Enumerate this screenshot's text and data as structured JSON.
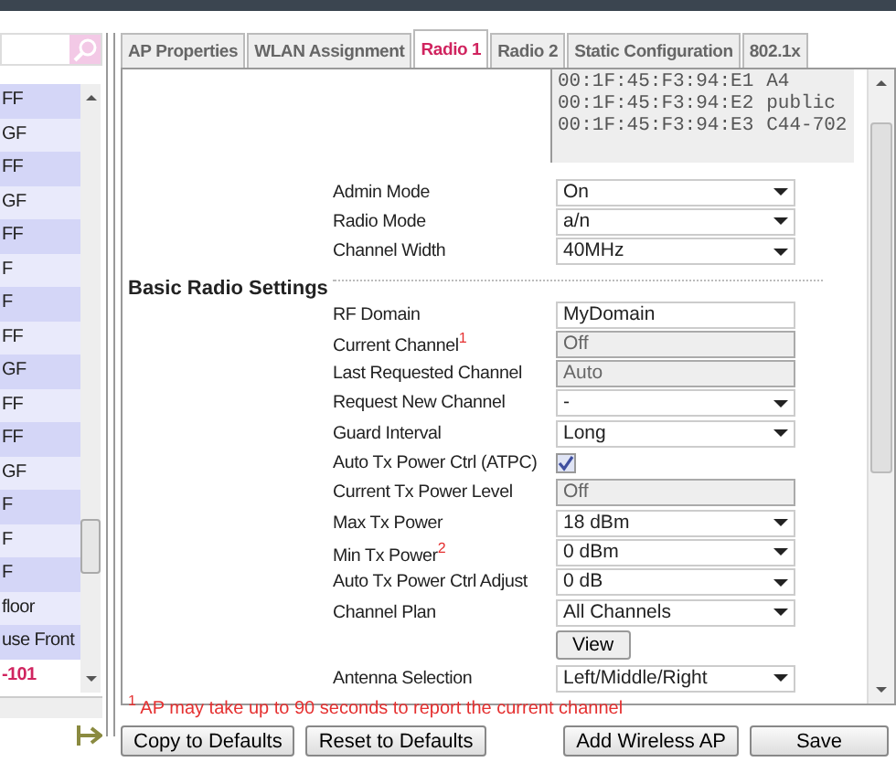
{
  "sidebar": {
    "items": [
      {
        "label": "FF",
        "selected": false
      },
      {
        "label": "GF",
        "selected": false
      },
      {
        "label": "FF",
        "selected": false
      },
      {
        "label": "GF",
        "selected": false
      },
      {
        "label": "FF",
        "selected": false
      },
      {
        "label": "F",
        "selected": false
      },
      {
        "label": "F",
        "selected": false
      },
      {
        "label": "FF",
        "selected": false
      },
      {
        "label": "GF",
        "selected": false
      },
      {
        "label": "FF",
        "selected": false
      },
      {
        "label": "FF",
        "selected": false
      },
      {
        "label": "GF",
        "selected": false
      },
      {
        "label": "F",
        "selected": false
      },
      {
        "label": "F",
        "selected": false
      },
      {
        "label": "F",
        "selected": false
      },
      {
        "label": "floor",
        "selected": false
      },
      {
        "label": "use Front",
        "selected": false
      },
      {
        "label": "-101",
        "selected": true
      }
    ]
  },
  "tabs": [
    {
      "label": "AP Properties",
      "selected": false
    },
    {
      "label": "WLAN Assignment",
      "selected": false
    },
    {
      "label": "Radio 1",
      "selected": true
    },
    {
      "label": "Radio 2",
      "selected": false
    },
    {
      "label": "Static Configuration",
      "selected": false
    },
    {
      "label": "802.1x",
      "selected": false
    }
  ],
  "wlan_list": [
    {
      "mac": "00:1F:45:F3:94:E1",
      "name": "A4"
    },
    {
      "mac": "00:1F:45:F3:94:E2",
      "name": "public"
    },
    {
      "mac": "00:1F:45:F3:94:E3",
      "name": "C44-702"
    }
  ],
  "top_fields": [
    {
      "label": "Admin Mode",
      "kind": "select",
      "value": "On"
    },
    {
      "label": "Radio Mode",
      "kind": "select",
      "value": "a/n"
    },
    {
      "label": "Channel Width",
      "kind": "select",
      "value": "40MHz"
    }
  ],
  "basic_radio_settings": {
    "heading": "Basic Radio Settings",
    "fields": [
      {
        "label": "RF Domain",
        "kind": "text",
        "value": "MyDomain"
      },
      {
        "label": "Current Channel",
        "note": "1",
        "kind": "readonly",
        "value": "Off"
      },
      {
        "label": "Last Requested Channel",
        "kind": "readonly",
        "value": "Auto"
      },
      {
        "label": "Request New Channel",
        "kind": "select",
        "value": "-"
      },
      {
        "label": "Guard Interval",
        "kind": "select",
        "value": "Long"
      },
      {
        "label": "Auto Tx Power Ctrl (ATPC)",
        "kind": "checkbox",
        "checked": true
      },
      {
        "label": "Current Tx Power Level",
        "kind": "readonly",
        "value": "Off"
      },
      {
        "label": "Max Tx Power",
        "kind": "select",
        "value": "18 dBm"
      },
      {
        "label": "Min Tx Power",
        "note": "2",
        "kind": "select",
        "value": "0 dBm"
      },
      {
        "label": "Auto Tx Power Ctrl Adjust",
        "kind": "select",
        "value": "0 dB"
      },
      {
        "label": "Channel Plan",
        "kind": "select",
        "value": "All Channels"
      },
      {
        "kind": "button",
        "value": "View"
      },
      {
        "label": "Antenna Selection",
        "kind": "select",
        "value": "Left/Middle/Right"
      }
    ]
  },
  "footnote": {
    "mark": "1",
    "text": "AP may take up to 90 seconds to report the current channel"
  },
  "buttons": [
    "Copy to Defaults",
    "Reset to Defaults",
    "Add Wireless AP",
    "Save"
  ]
}
